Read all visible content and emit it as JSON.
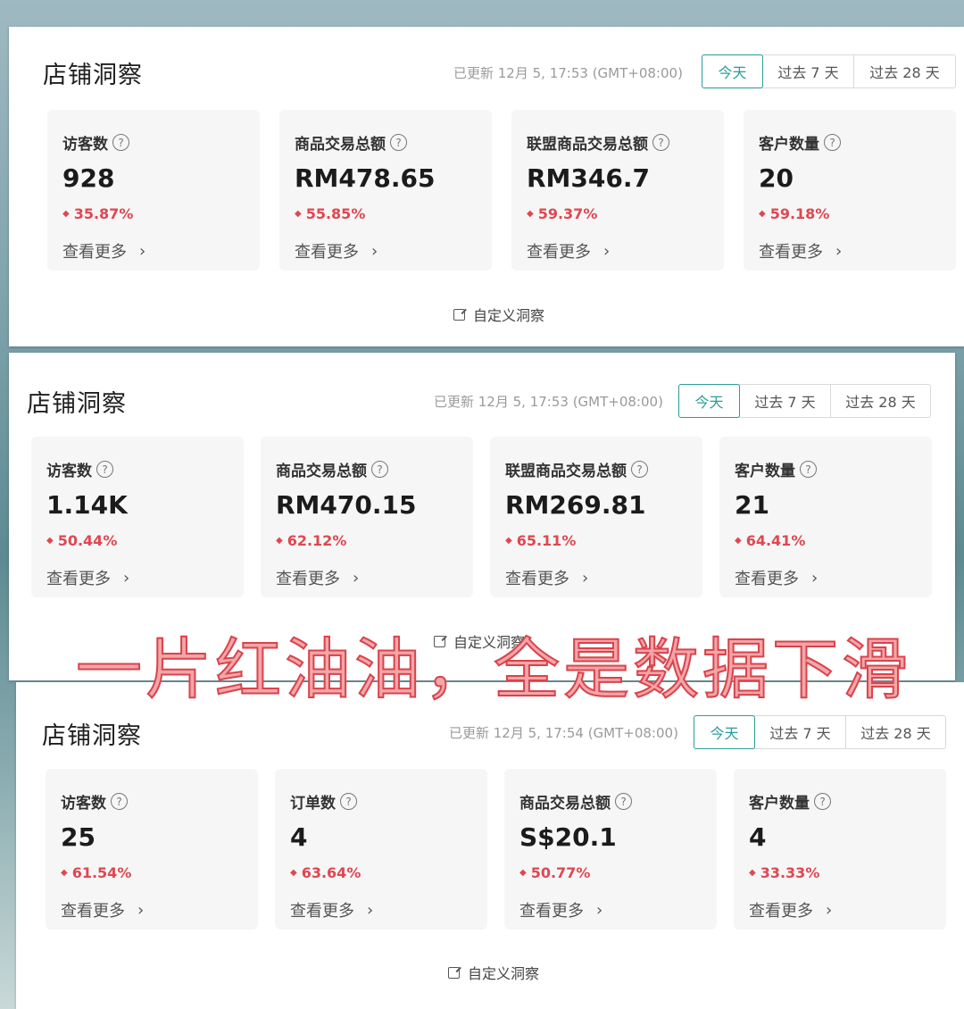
{
  "panels": [
    {
      "title": "店铺洞察",
      "updated": "已更新 12月 5, 17:53 (GMT+08:00)",
      "tabs": [
        "今天",
        "过去 7 天",
        "过去 28 天"
      ],
      "active_tab": "今天",
      "cards": [
        {
          "label": "访客数",
          "value": "928",
          "change": "35.87%",
          "more": "查看更多"
        },
        {
          "label": "商品交易总额",
          "value": "RM478.65",
          "change": "55.85%",
          "more": "查看更多"
        },
        {
          "label": "联盟商品交易总额",
          "value": "RM346.7",
          "change": "59.37%",
          "more": "查看更多"
        },
        {
          "label": "客户数量",
          "value": "20",
          "change": "59.18%",
          "more": "查看更多"
        }
      ],
      "customize": "自定义洞察"
    },
    {
      "title": "店铺洞察",
      "updated": "已更新 12月 5, 17:53 (GMT+08:00)",
      "tabs": [
        "今天",
        "过去 7 天",
        "过去 28 天"
      ],
      "active_tab": "今天",
      "cards": [
        {
          "label": "访客数",
          "value": "1.14K",
          "change": "50.44%",
          "more": "查看更多"
        },
        {
          "label": "商品交易总额",
          "value": "RM470.15",
          "change": "62.12%",
          "more": "查看更多"
        },
        {
          "label": "联盟商品交易总额",
          "value": "RM269.81",
          "change": "65.11%",
          "more": "查看更多"
        },
        {
          "label": "客户数量",
          "value": "21",
          "change": "64.41%",
          "more": "查看更多"
        }
      ],
      "customize": "自定义洞察"
    },
    {
      "title": "店铺洞察",
      "updated": "已更新 12月 5, 17:54 (GMT+08:00)",
      "tabs": [
        "今天",
        "过去 7 天",
        "过去 28 天"
      ],
      "active_tab": "今天",
      "cards": [
        {
          "label": "访客数",
          "value": "25",
          "change": "61.54%",
          "more": "查看更多"
        },
        {
          "label": "订单数",
          "value": "4",
          "change": "63.64%",
          "more": "查看更多"
        },
        {
          "label": "商品交易总额",
          "value": "S$20.1",
          "change": "50.77%",
          "more": "查看更多"
        },
        {
          "label": "客户数量",
          "value": "4",
          "change": "33.33%",
          "more": "查看更多"
        }
      ],
      "customize": "自定义洞察"
    }
  ],
  "caption": "一片红油油，全是数据下滑",
  "icons": {
    "help": "question-circle-icon",
    "down": "down-arrow-icon",
    "chevron": "chevron-right-icon",
    "edit": "edit-icon"
  },
  "colors": {
    "accent": "#2a9d98",
    "decrease": "#e0474f"
  }
}
